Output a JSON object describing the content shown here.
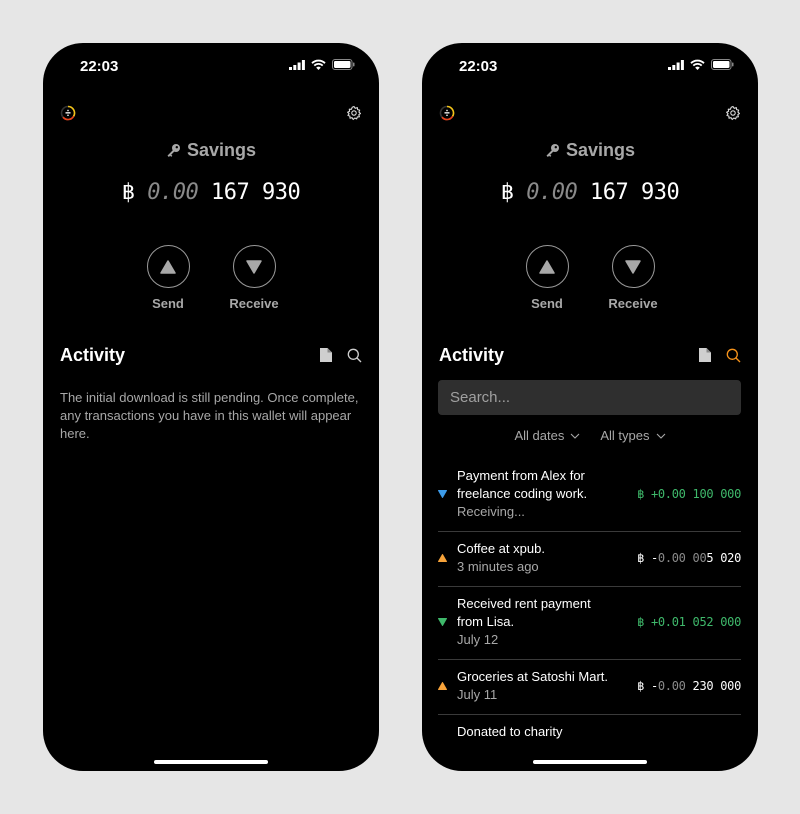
{
  "colors": {
    "accent": "#f7931a",
    "incoming": "#3fb96b",
    "outgoing_icon": "#f7a33a",
    "pending_icon": "#3d9be9",
    "muted": "#a8a8a8"
  },
  "screens": [
    {
      "status_bar": {
        "time": "22:03"
      },
      "wallet": {
        "title": "Savings",
        "balance_symbol": "฿",
        "balance_dim": "0.00",
        "balance_main": "167 930"
      },
      "actions": {
        "send_label": "Send",
        "receive_label": "Receive"
      },
      "activity": {
        "title": "Activity",
        "empty_message": "The initial download is still pending. Once complete, any transactions you have in this wallet will appear here."
      }
    },
    {
      "status_bar": {
        "time": "22:03"
      },
      "wallet": {
        "title": "Savings",
        "balance_symbol": "฿",
        "balance_dim": "0.00",
        "balance_main": "167 930"
      },
      "actions": {
        "send_label": "Send",
        "receive_label": "Receive"
      },
      "activity": {
        "title": "Activity",
        "search_placeholder": "Search...",
        "search_value": "",
        "filters": {
          "dates": "All dates",
          "types": "All types"
        },
        "transactions": [
          {
            "direction": "incoming",
            "status_icon": "pending-down-triangle",
            "description": "Payment from Alex for freelance coding work.",
            "subtitle": "Receiving...",
            "symbol": "฿",
            "sign": "+",
            "amount_dim": "0.00",
            "amount_main": "100 000"
          },
          {
            "direction": "outgoing",
            "status_icon": "up-triangle",
            "description": "Coffee at xpub.",
            "subtitle": "3 minutes ago",
            "symbol": "฿",
            "sign": "-",
            "amount_dim": "0.00 00",
            "amount_main": "5 020"
          },
          {
            "direction": "incoming",
            "status_icon": "down-triangle",
            "description": "Received rent payment from Lisa.",
            "subtitle": "July 12",
            "symbol": "฿",
            "sign": "+",
            "amount_dim": "0.01",
            "amount_main": "052 000"
          },
          {
            "direction": "outgoing",
            "status_icon": "up-triangle",
            "description": "Groceries at Satoshi Mart.",
            "subtitle": "July 11",
            "symbol": "฿",
            "sign": "-",
            "amount_dim": "0.00",
            "amount_main": "230 000"
          },
          {
            "direction": "outgoing",
            "status_icon": "up-triangle",
            "description": "Donated to charity",
            "subtitle": "",
            "symbol": "",
            "sign": "",
            "amount_dim": "",
            "amount_main": ""
          }
        ]
      }
    }
  ]
}
